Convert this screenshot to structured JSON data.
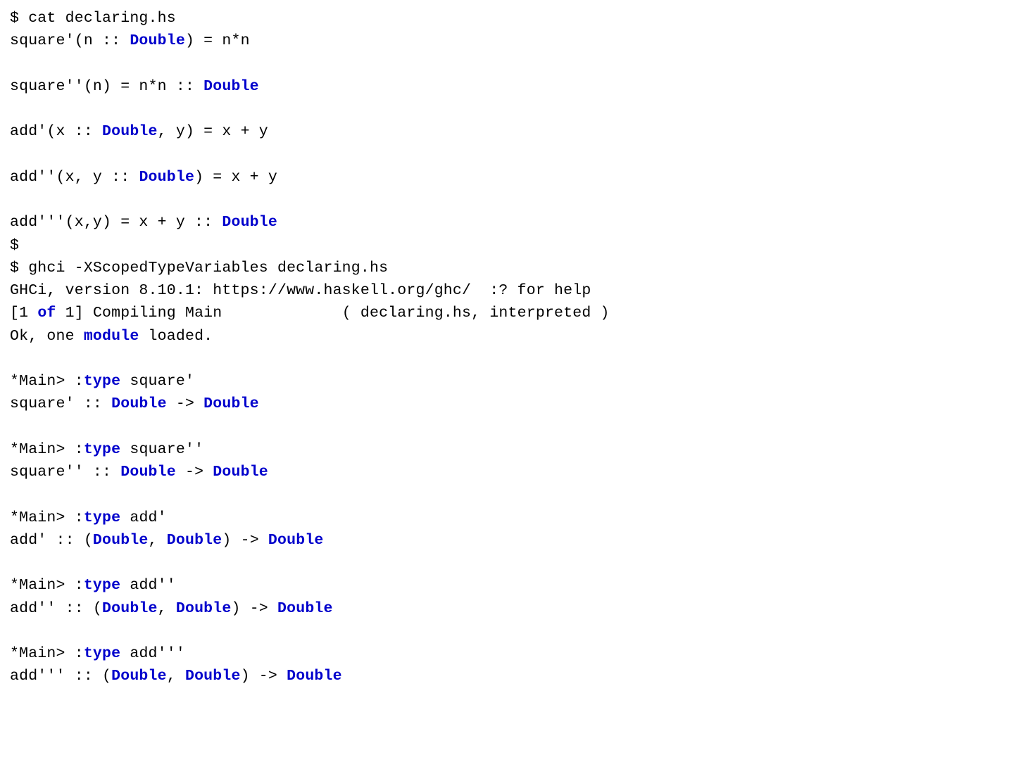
{
  "lines": [
    {
      "segs": [
        {
          "t": "$ cat declaring.hs"
        }
      ]
    },
    {
      "segs": [
        {
          "t": "square'(n :: "
        },
        {
          "t": "Double",
          "k": true
        },
        {
          "t": ") = n*n"
        }
      ]
    },
    {
      "segs": [
        {
          "t": ""
        }
      ]
    },
    {
      "segs": [
        {
          "t": "square''(n) = n*n :: "
        },
        {
          "t": "Double",
          "k": true
        }
      ]
    },
    {
      "segs": [
        {
          "t": ""
        }
      ]
    },
    {
      "segs": [
        {
          "t": "add'(x :: "
        },
        {
          "t": "Double",
          "k": true
        },
        {
          "t": ", y) = x + y"
        }
      ]
    },
    {
      "segs": [
        {
          "t": ""
        }
      ]
    },
    {
      "segs": [
        {
          "t": "add''(x, y :: "
        },
        {
          "t": "Double",
          "k": true
        },
        {
          "t": ") = x + y"
        }
      ]
    },
    {
      "segs": [
        {
          "t": ""
        }
      ]
    },
    {
      "segs": [
        {
          "t": "add'''(x,y) = x + y :: "
        },
        {
          "t": "Double",
          "k": true
        }
      ]
    },
    {
      "segs": [
        {
          "t": "$"
        }
      ]
    },
    {
      "segs": [
        {
          "t": "$ ghci -XScopedTypeVariables declaring.hs"
        }
      ]
    },
    {
      "segs": [
        {
          "t": "GHCi, version 8.10.1: https://www.haskell.org/ghc/  :? for help"
        }
      ]
    },
    {
      "segs": [
        {
          "t": "[1 "
        },
        {
          "t": "of",
          "k": true
        },
        {
          "t": " 1] Compiling Main             ( declaring.hs, interpreted )"
        }
      ]
    },
    {
      "segs": [
        {
          "t": "Ok, one "
        },
        {
          "t": "module",
          "k": true
        },
        {
          "t": " loaded."
        }
      ]
    },
    {
      "segs": [
        {
          "t": ""
        }
      ]
    },
    {
      "segs": [
        {
          "t": "*Main> :"
        },
        {
          "t": "type",
          "k": true
        },
        {
          "t": " square'"
        }
      ]
    },
    {
      "segs": [
        {
          "t": "square' :: "
        },
        {
          "t": "Double",
          "k": true
        },
        {
          "t": " -> "
        },
        {
          "t": "Double",
          "k": true
        }
      ]
    },
    {
      "segs": [
        {
          "t": ""
        }
      ]
    },
    {
      "segs": [
        {
          "t": "*Main> :"
        },
        {
          "t": "type",
          "k": true
        },
        {
          "t": " square''"
        }
      ]
    },
    {
      "segs": [
        {
          "t": "square'' :: "
        },
        {
          "t": "Double",
          "k": true
        },
        {
          "t": " -> "
        },
        {
          "t": "Double",
          "k": true
        }
      ]
    },
    {
      "segs": [
        {
          "t": ""
        }
      ]
    },
    {
      "segs": [
        {
          "t": "*Main> :"
        },
        {
          "t": "type",
          "k": true
        },
        {
          "t": " add'"
        }
      ]
    },
    {
      "segs": [
        {
          "t": "add' :: ("
        },
        {
          "t": "Double",
          "k": true
        },
        {
          "t": ", "
        },
        {
          "t": "Double",
          "k": true
        },
        {
          "t": ") -> "
        },
        {
          "t": "Double",
          "k": true
        }
      ]
    },
    {
      "segs": [
        {
          "t": ""
        }
      ]
    },
    {
      "segs": [
        {
          "t": "*Main> :"
        },
        {
          "t": "type",
          "k": true
        },
        {
          "t": " add''"
        }
      ]
    },
    {
      "segs": [
        {
          "t": "add'' :: ("
        },
        {
          "t": "Double",
          "k": true
        },
        {
          "t": ", "
        },
        {
          "t": "Double",
          "k": true
        },
        {
          "t": ") -> "
        },
        {
          "t": "Double",
          "k": true
        }
      ]
    },
    {
      "segs": [
        {
          "t": ""
        }
      ]
    },
    {
      "segs": [
        {
          "t": "*Main> :"
        },
        {
          "t": "type",
          "k": true
        },
        {
          "t": " add'''"
        }
      ]
    },
    {
      "segs": [
        {
          "t": "add''' :: ("
        },
        {
          "t": "Double",
          "k": true
        },
        {
          "t": ", "
        },
        {
          "t": "Double",
          "k": true
        },
        {
          "t": ") -> "
        },
        {
          "t": "Double",
          "k": true
        }
      ]
    }
  ]
}
